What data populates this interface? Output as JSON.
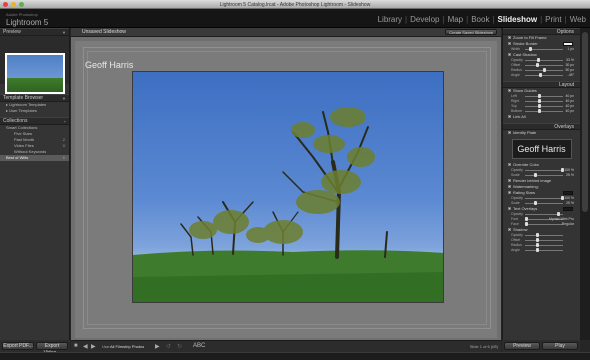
{
  "window": {
    "title": "Lightroom 5 Catalog.lrcat - Adobe Photoshop Lightroom - Slideshow"
  },
  "identity_plate": {
    "adobe_label": "Adobe Photoshop",
    "product": "Lightroom 5"
  },
  "modules": [
    {
      "label": "Library",
      "active": false
    },
    {
      "label": "Develop",
      "active": false
    },
    {
      "label": "Map",
      "active": false
    },
    {
      "label": "Book",
      "active": false
    },
    {
      "label": "Slideshow",
      "active": true
    },
    {
      "label": "Print",
      "active": false
    },
    {
      "label": "Web",
      "active": false
    }
  ],
  "left_panel": {
    "preview_title": "Preview",
    "template_browser_title": "Template Browser",
    "templates": [
      "Lightroom Templates",
      "User Templates"
    ],
    "collections_title": "Collections",
    "collections": [
      {
        "label": "Smart Collections",
        "count": ""
      },
      {
        "label": "Five Stars",
        "count": ""
      },
      {
        "label": "Past Month",
        "count": "2"
      },
      {
        "label": "Video Files",
        "count": "0"
      },
      {
        "label": "Without Keywords",
        "count": ""
      },
      {
        "label": "Best of Wilts",
        "count": "6"
      }
    ],
    "export_pdf": "Export PDF...",
    "export_video": "Export Video..."
  },
  "center": {
    "slideshow_name": "Unsaved Slideshow",
    "create_button": "Create Saved Slideshow",
    "identity_text": "Geoff Harris"
  },
  "toolbar": {
    "use_label": "Use:",
    "use_value": "All Filmstrip Photos",
    "abc": "ABC",
    "slide_count": "Slide 1 of 6 (f/8)"
  },
  "right_panel": {
    "options_title": "Options",
    "options_rows": [
      {
        "type": "check",
        "label": "Zoom to Fill Frame"
      },
      {
        "type": "check",
        "label": "Stroke Border",
        "swatch": "#f2f2f2"
      },
      {
        "type": "slider",
        "label": "Width",
        "value": "1 px",
        "level": 0.1
      },
      {
        "type": "check",
        "label": "Cast Shadow"
      },
      {
        "type": "slider",
        "label": "Opacity",
        "value": "33 %",
        "level": 0.33
      },
      {
        "type": "slider",
        "label": "Offset",
        "value": "30 px",
        "level": 0.3
      },
      {
        "type": "slider",
        "label": "Radius",
        "value": "50 px",
        "level": 0.5
      },
      {
        "type": "slider",
        "label": "Angle",
        "value": "-45°",
        "level": 0.4
      }
    ],
    "layout_title": "Layout",
    "layout_rows": [
      {
        "type": "check",
        "label": "Show Guides"
      },
      {
        "type": "slider",
        "label": "Left",
        "value": "40 px",
        "level": 0.35
      },
      {
        "type": "slider",
        "label": "Right",
        "value": "40 px",
        "level": 0.35
      },
      {
        "type": "slider",
        "label": "Top",
        "value": "40 px",
        "level": 0.35
      },
      {
        "type": "slider",
        "label": "Bottom",
        "value": "40 px",
        "level": 0.35
      },
      {
        "type": "check",
        "label": "Link All"
      }
    ],
    "overlays_title": "Overlays",
    "overlays_rows_top": [
      {
        "type": "check",
        "label": "Identity Plate"
      }
    ],
    "identity_preview": "Geoff Harris",
    "overlays_rows_mid": [
      {
        "type": "check",
        "label": "Override Color"
      },
      {
        "type": "slider",
        "label": "Opacity",
        "value": "100 %",
        "level": 1.0
      },
      {
        "type": "slider",
        "label": "Scale",
        "value": "25 %",
        "level": 0.25
      },
      {
        "type": "check",
        "label": "Render behind image"
      },
      {
        "type": "check",
        "label": "Watermarking:"
      },
      {
        "type": "check",
        "label": "Rating Stars",
        "swatch": "#1a1a1a"
      },
      {
        "type": "slider",
        "label": "Opacity",
        "value": "100 %",
        "level": 1.0
      },
      {
        "type": "slider",
        "label": "Scale",
        "value": "25 %",
        "level": 0.25
      },
      {
        "type": "check",
        "label": "Text Overlays",
        "swatch": "#1a1a1a"
      },
      {
        "type": "slider",
        "label": "Opacity",
        "value": "",
        "level": 0.9
      },
      {
        "type": "slider",
        "label": "Font",
        "value": "Myriad Web Pro",
        "level": 0
      },
      {
        "type": "slider",
        "label": "Face",
        "value": "Regular",
        "level": 0
      },
      {
        "type": "check",
        "label": "Shadow"
      },
      {
        "type": "slider",
        "label": "Opacity",
        "value": "",
        "level": 0.3
      },
      {
        "type": "slider",
        "label": "Offset",
        "value": "",
        "level": 0.3
      },
      {
        "type": "slider",
        "label": "Radius",
        "value": "",
        "level": 0.3
      },
      {
        "type": "slider",
        "label": "Angle",
        "value": "",
        "level": 0.3
      }
    ],
    "preview_button": "Preview",
    "play_button": "Play"
  }
}
